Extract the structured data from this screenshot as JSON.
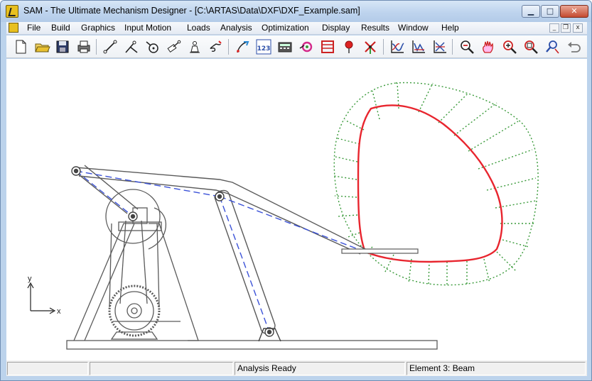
{
  "window": {
    "title": "SAM - The Ultimate Mechanism Designer - [C:\\ARTAS\\Data\\DXF\\DXF_Example.sam]",
    "minimize_glyph": "▁",
    "maximize_glyph": "□",
    "close_glyph": "✕"
  },
  "menubar": {
    "items": [
      "File",
      "Build",
      "Graphics",
      "Input Motion",
      "Loads",
      "Analysis",
      "Optimization",
      "Display",
      "Results",
      "Window",
      "Help"
    ],
    "mdi_minimize": "_",
    "mdi_restore": "❐",
    "mdi_close": "x"
  },
  "toolbar": {
    "icons": [
      "new-file-icon",
      "open-folder-icon",
      "save-disk-icon",
      "print-icon",
      "beam-icon",
      "truss-icon",
      "gear-wheel-icon",
      "slider-icon",
      "weight-icon",
      "spring-icon",
      "path-icon",
      "numeric-input-icon",
      "calculator-icon",
      "motion-icon",
      "abacus-icon",
      "pin-icon",
      "windmill-icon",
      "chart-xy-icon",
      "chart-bars-icon",
      "chart-multi-icon",
      "zoom-out-icon",
      "pan-icon",
      "zoom-window-icon",
      "zoom-fit-icon",
      "magnify-icon",
      "undo-icon"
    ],
    "numeric_label": "123"
  },
  "canvas": {
    "axis_x": "x",
    "axis_y": "y",
    "colors": {
      "trace": "#e8252e",
      "envelope": "#3a9a3a",
      "centerline": "#3b52d8",
      "outline": "#5a5a5a"
    }
  },
  "statusbar": {
    "pane1": "",
    "pane2": "",
    "pane3": "Analysis Ready",
    "pane4": "Element 3: Beam"
  }
}
